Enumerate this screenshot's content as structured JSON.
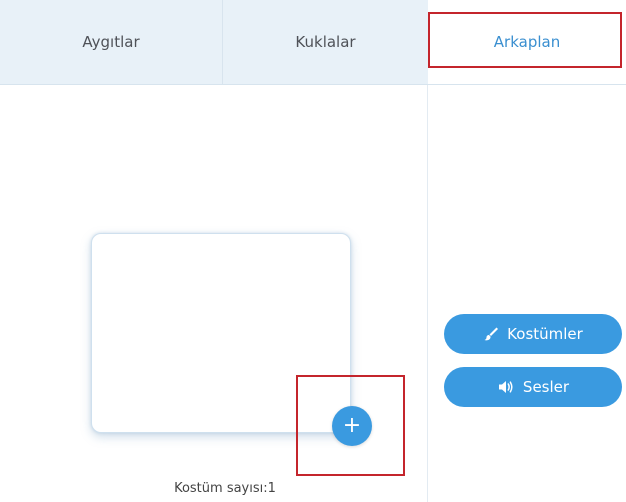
{
  "tabs": {
    "devices": "Aygıtlar",
    "puppets": "Kuklalar",
    "background": "Arkaplan"
  },
  "costume_panel": {
    "add_glyph": "+",
    "count_label": "Kostüm sayısı:1"
  },
  "side_buttons": {
    "costumes": "Kostümler",
    "sounds": "Sesler"
  },
  "icons": {
    "costumes": "brush-icon",
    "sounds": "speaker-icon"
  },
  "colors": {
    "accent": "#3a9ae0",
    "highlight": "#c4252c",
    "tabbar": "#e8f1f8"
  }
}
